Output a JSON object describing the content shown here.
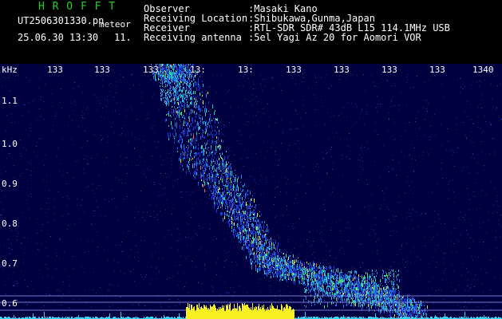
{
  "header": {
    "program_name": "H R O F F T",
    "filename": "UT2506301330.pn",
    "meteor_label": "meteor",
    "datetime": "25.06.30 13:30",
    "count": "11.",
    "fields": [
      {
        "label": "Observer",
        "value": ":Masaki Kano"
      },
      {
        "label": "Receiving Location",
        "value": ":Shibukawa,Gunma,Japan"
      },
      {
        "label": "Receiver",
        "value": ":RTL-SDR SDR# 43dB L15 114.1MHz USB"
      },
      {
        "label": "Receiving antenna",
        "value": ":5el Yagi Az 20 for Aomori VOR"
      }
    ]
  },
  "plot": {
    "y_unit": "kHz",
    "x_ticks": [
      "133",
      "133",
      "133",
      "13:",
      "13:",
      "133",
      "133",
      "133",
      "133",
      "1340"
    ],
    "y_ticks": [
      "1.1",
      "1.0",
      "0.9",
      "0.8",
      "0.7",
      "0.6"
    ],
    "background_color": "#000040",
    "noise_color": "#1a2a9a",
    "signal_colors": [
      "#1a3ad8",
      "#2a7ad8",
      "#20c8d0",
      "#40e070",
      "#e0e040",
      "#ff6040"
    ],
    "bottom_trace_color": "#30d8f8",
    "bottom_burst_color": "#f8f020"
  }
}
